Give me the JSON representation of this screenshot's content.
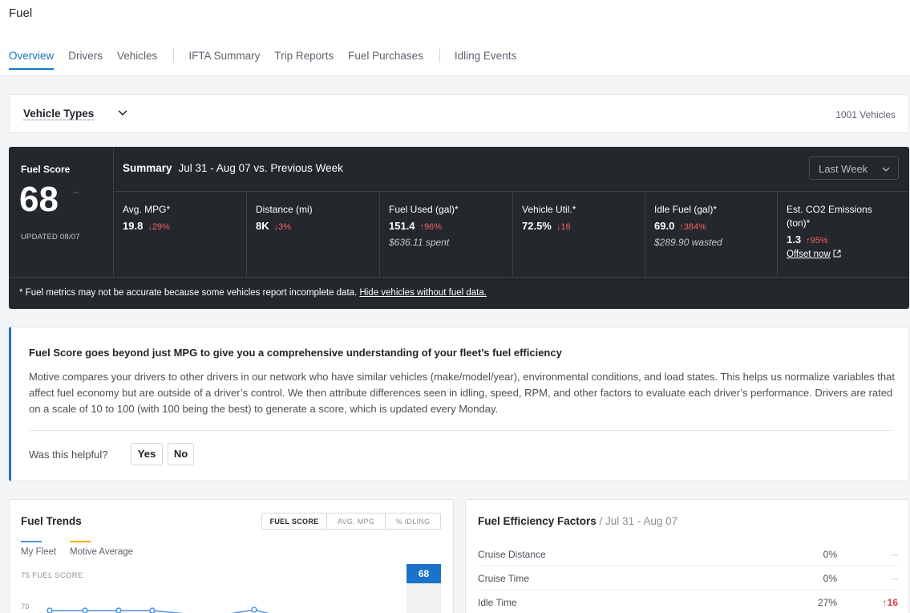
{
  "page": {
    "title": "Fuel"
  },
  "tabs": [
    {
      "label": "Overview"
    },
    {
      "label": "Drivers"
    },
    {
      "label": "Vehicles"
    },
    {
      "label": "IFTA Summary"
    },
    {
      "label": "Trip Reports"
    },
    {
      "label": "Fuel Purchases"
    },
    {
      "label": "Idling Events"
    }
  ],
  "filter": {
    "vehicle_types": "Vehicle Types",
    "vehicle_count": "1001 Vehicles"
  },
  "score": {
    "label": "Fuel Score",
    "value": "68",
    "trend": "--",
    "updated": "UPDATED 08/07"
  },
  "summary": {
    "title": "Summary",
    "period": "Jul 31 - Aug 07 vs. Previous Week",
    "range_select": "Last Week"
  },
  "metrics": [
    {
      "label": "Avg. MPG*",
      "value": "19.8",
      "change": "↓29%"
    },
    {
      "label": "Distance (mi)",
      "value": "8K",
      "change": "↓3%"
    },
    {
      "label": "Fuel Used (gal)*",
      "value": "151.4",
      "change": "↑96%",
      "sub": "$636.11 spent"
    },
    {
      "label": "Vehicle Util.*",
      "value": "72.5%",
      "change": "↓16"
    },
    {
      "label": "Idle Fuel (gal)*",
      "value": "69.0",
      "change": "↑384%",
      "sub": "$289.90 wasted"
    },
    {
      "label": "Est. CO2 Emissions",
      "label2": "(ton)*",
      "value": "1.3",
      "change": "↑95%",
      "link": "Offset now"
    }
  ],
  "note": {
    "text": "* Fuel metrics may not be accurate because some vehicles report incomplete data.",
    "link": "Hide vehicles without fuel data."
  },
  "info": {
    "title": "Fuel Score goes beyond just MPG to give you a comprehensive understanding of your fleet’s fuel efficiency",
    "body": "Motive compares your drivers to other drivers in our network who have similar vehicles (make/model/year), environmental conditions, and load states. This helps us normalize variables that affect fuel economy but are outside of a driver’s control. We then attribute differences seen in idling, speed, RPM, and other factors to evaluate each driver’s performance. Drivers are rated on a scale of 10 to 100 (with 100 being the best) to generate a score, which is updated every Monday.",
    "question": "Was this helpful?",
    "yes": "Yes",
    "no": "No"
  },
  "trends": {
    "title": "Fuel Trends",
    "toggles": [
      "FUEL SCORE",
      "AVG. MPG",
      "% IDLING"
    ],
    "legend": [
      {
        "name": "My Fleet",
        "color": "#4a90e2"
      },
      {
        "name": "Motive Average",
        "color": "#f5a623"
      }
    ],
    "y_axis_title": "75 FUEL SCORE",
    "y_tick": "70",
    "latest_value": "68"
  },
  "factors": {
    "title": "Fuel Efficiency Factors",
    "period": " / Jul 31 - Aug 07",
    "rows": [
      {
        "name": "Cruise Distance",
        "pct": "0%",
        "change": "--"
      },
      {
        "name": "Cruise Time",
        "pct": "0%",
        "change": "--"
      },
      {
        "name": "Idle Time",
        "pct": "27%",
        "change": "↑16"
      }
    ]
  },
  "colors": {
    "accent": "#1a73c8",
    "panel": "#24272b",
    "negative": "#f06464"
  }
}
